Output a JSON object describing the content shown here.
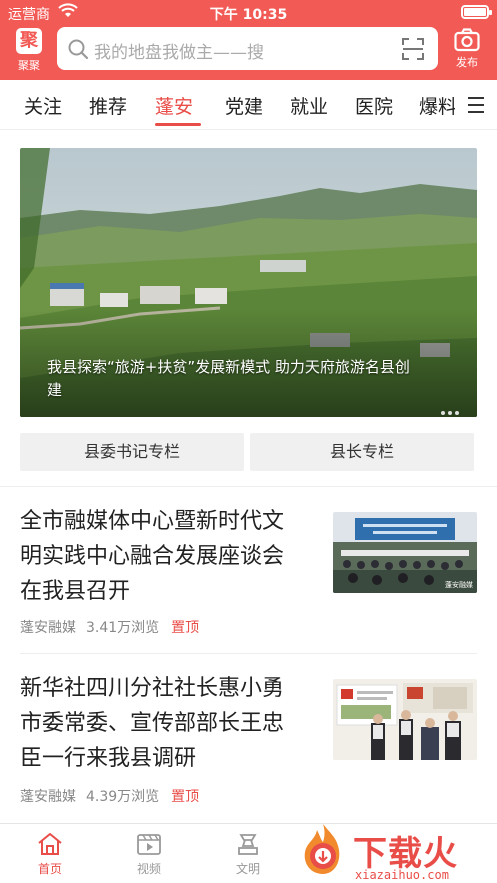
{
  "status_bar": {
    "carrier": "运营商",
    "time": "下午 10:35"
  },
  "header": {
    "logo_label": "聚聚",
    "logo_char": "聚",
    "search_placeholder": "我的地盘我做主——搜",
    "publish_label": "发布"
  },
  "tabs": [
    {
      "label": "关注",
      "active": false
    },
    {
      "label": "推荐",
      "active": false
    },
    {
      "label": "蓬安",
      "active": true
    },
    {
      "label": "党建",
      "active": false
    },
    {
      "label": "就业",
      "active": false
    },
    {
      "label": "医院",
      "active": false
    },
    {
      "label": "爆料",
      "active": false
    }
  ],
  "banner": {
    "caption": "我县探索“旅游+扶贫”发展新模式 助力天府旅游名县创建"
  },
  "columns": {
    "secretary": "县委书记专栏",
    "governor": "县长专栏"
  },
  "news": [
    {
      "title": "全市融媒体中心暨新时代文明实践中心融合发展座谈会在我县召开",
      "source": "蓬安融媒",
      "views": "3.41万浏览",
      "tag": "置顶",
      "thumb_watermark": "蓬安融媒"
    },
    {
      "title": "新华社四川分社社长惠小勇市委常委、宣传部部长王忠臣一行来我县调研",
      "source": "蓬安融媒",
      "views": "4.39万浏览",
      "tag": "置顶"
    }
  ],
  "bottom_nav": [
    {
      "label": "首页",
      "icon": "home-icon",
      "active": true
    },
    {
      "label": "视频",
      "icon": "video-icon",
      "active": false
    },
    {
      "label": "文明",
      "icon": "civilization-icon",
      "active": false
    }
  ],
  "watermark": {
    "text": "下载火",
    "sub": "xiazaihuo.com"
  },
  "colors": {
    "brand_red": "#f25a55",
    "accent_red": "#e94d48"
  }
}
